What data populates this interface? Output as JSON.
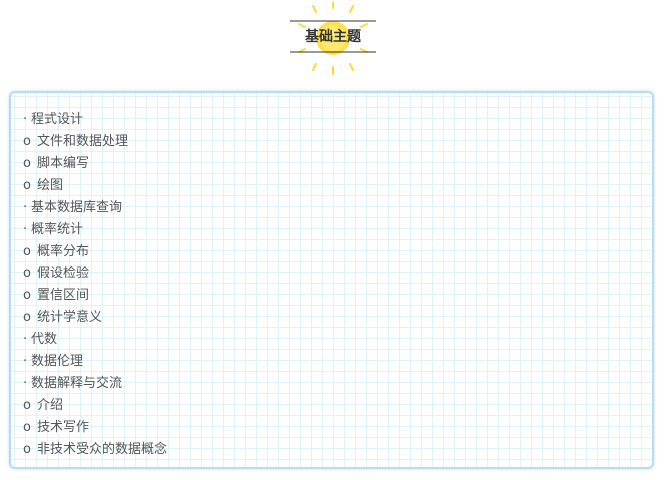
{
  "heading": {
    "title": "基础主题"
  },
  "colors": {
    "sun": "#ffe14d",
    "sun_ray": "#ffd83a",
    "panel_border": "#b9dcef",
    "grid": "#dff3fb",
    "text": "#555555"
  },
  "topics": [
    {
      "marker": "·",
      "label": "程式设计",
      "level": "main"
    },
    {
      "marker": "o",
      "label": "文件和数据处理",
      "level": "sub"
    },
    {
      "marker": "o",
      "label": "脚本编写",
      "level": "sub"
    },
    {
      "marker": "o",
      "label": "绘图",
      "level": "sub"
    },
    {
      "marker": "·",
      "label": "基本数据库查询",
      "level": "main"
    },
    {
      "marker": "·",
      "label": "概率统计",
      "level": "main"
    },
    {
      "marker": "o",
      "label": "概率分布",
      "level": "sub"
    },
    {
      "marker": "o",
      "label": "假设检验",
      "level": "sub"
    },
    {
      "marker": "o",
      "label": "置信区间",
      "level": "sub"
    },
    {
      "marker": "o",
      "label": "统计学意义",
      "level": "sub"
    },
    {
      "marker": "·",
      "label": "代数",
      "level": "main"
    },
    {
      "marker": "·",
      "label": "数据伦理",
      "level": "main"
    },
    {
      "marker": "·",
      "label": "数据解释与交流",
      "level": "main"
    },
    {
      "marker": "o",
      "label": "介绍",
      "level": "sub"
    },
    {
      "marker": "o",
      "label": "技术写作",
      "level": "sub"
    },
    {
      "marker": "o",
      "label": "非技术受众的数据概念",
      "level": "sub"
    }
  ]
}
